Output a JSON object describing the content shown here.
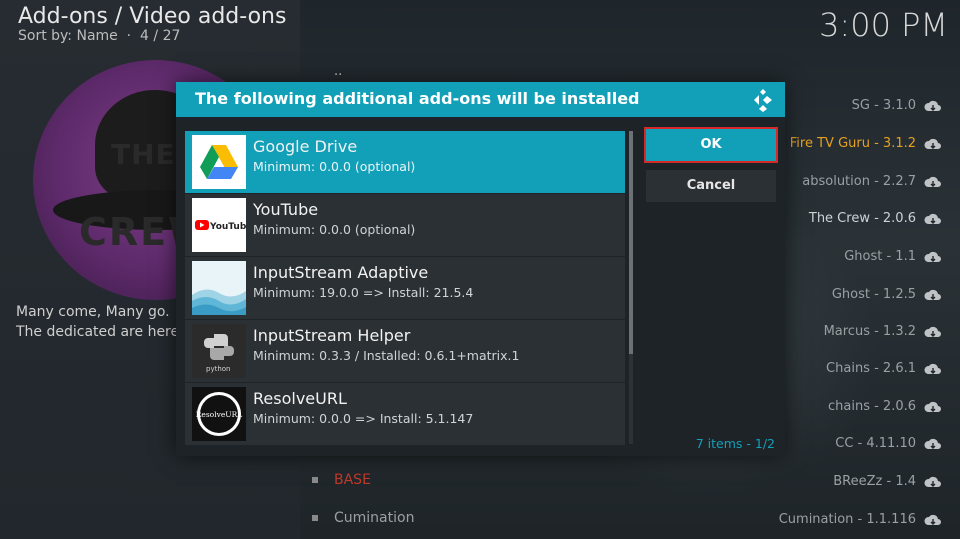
{
  "header": {
    "breadcrumb": "Add-ons / Video add-ons",
    "sort_label": "Sort by: Name",
    "position": "4 / 27",
    "clock": "3:00 PM"
  },
  "left_panel": {
    "logo_line1": "THE",
    "logo_line2": "CREW",
    "description": "Many come, Many go. The dedicated are here."
  },
  "background_list": {
    "parent": "..",
    "items": [
      {
        "label": "SG - 3.1.0"
      },
      {
        "label": "Fire TV Guru - 3.1.2"
      },
      {
        "label": "absolution - 2.2.7"
      },
      {
        "label": "The Crew - 2.0.6"
      },
      {
        "label": "Ghost - 1.1"
      },
      {
        "label": "Ghost - 1.2.5"
      },
      {
        "label": "Marcus - 1.3.2"
      },
      {
        "label": "Chains - 2.6.1"
      },
      {
        "label": "chains - 2.0.6"
      },
      {
        "label": "CC - 4.11.10"
      },
      {
        "label": "BReeZz - 1.4"
      },
      {
        "label": "Cumination - 1.1.116"
      }
    ],
    "left_items": [
      {
        "label": "BASE"
      },
      {
        "label": "Cumination"
      }
    ]
  },
  "dialog": {
    "title": "The following additional add-ons will be installed",
    "items": [
      {
        "name": "Google Drive",
        "requirement": "Minimum: 0.0.0 (optional)"
      },
      {
        "name": "YouTube",
        "requirement": "Minimum: 0.0.0 (optional)"
      },
      {
        "name": "InputStream Adaptive",
        "requirement": "Minimum: 19.0.0 => Install: 21.5.4"
      },
      {
        "name": "InputStream Helper",
        "requirement": "Minimum: 0.3.3 / Installed: 0.6.1+matrix.1"
      },
      {
        "name": "ResolveURL",
        "requirement": "Minimum: 0.0.0 => Install: 5.1.147"
      }
    ],
    "thumb_text": {
      "youtube": "YouTube",
      "python": "python",
      "resolve": "ResolveURL"
    },
    "ok_label": "OK",
    "cancel_label": "Cancel",
    "count": "7 items",
    "page": "1/2"
  },
  "colors": {
    "accent": "#12a0b8",
    "focus_outline": "#d62a2a",
    "highlight": "#e5a020"
  }
}
